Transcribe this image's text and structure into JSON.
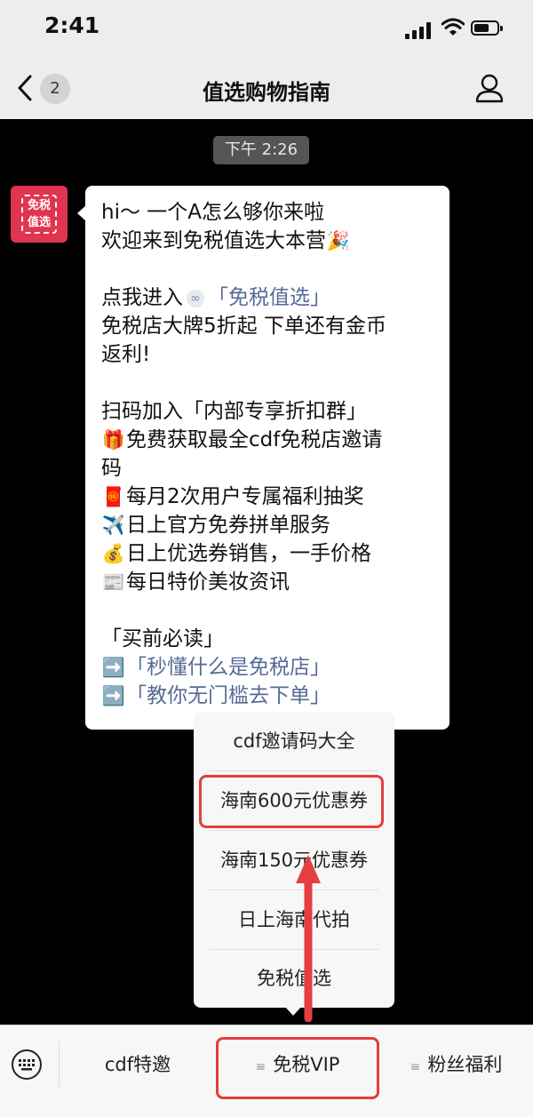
{
  "status": {
    "time": "2:41"
  },
  "nav": {
    "back_count": "2",
    "title": "值选购物指南"
  },
  "chat": {
    "timestamp": "下午 2:26",
    "avatar_text": [
      "免税",
      "值选"
    ],
    "message": {
      "l1": "hi～ 一个A怎么够你来啦",
      "l2": "欢迎来到免税值选大本营",
      "l2_emoji": "🎉",
      "l3_prefix": "点我进入",
      "l3_link": "「免税值选」",
      "l4": "免税店大牌5折起 下单还有金币",
      "l5": "返利!",
      "l6": "扫码加入「内部专享折扣群」",
      "l7_emoji": "🎁",
      "l7": "免费获取最全cdf免税店邀请",
      "l8": "码",
      "l9_emoji": "🧧",
      "l9": "每月2次用户专属福利抽奖",
      "l10_emoji": "✈️",
      "l10": "日上官方免券拼单服务",
      "l11_emoji": "💰",
      "l11": "日上优选券销售，一手价格",
      "l12_emoji": "📰",
      "l12": "每日特价美妆资讯",
      "l13": "「买前必读」",
      "l14_emoji": "➡️",
      "l14_link": "「秒懂什么是免税店」",
      "l15_emoji": "➡️",
      "l15_link": "「教你无门槛去下单」"
    }
  },
  "popup_menu": {
    "items": [
      "cdf邀请码大全",
      "海南600元优惠券",
      "海南150元优惠券",
      "日上海南代拍",
      "免税值选"
    ]
  },
  "bottom_tabs": {
    "tab1": "cdf特邀",
    "tab2": "免税VIP",
    "tab3": "粉丝福利",
    "menu_marker": "≡"
  },
  "colors": {
    "highlight": "#e53e3e",
    "link": "#576b95",
    "avatar": "#e0344f"
  }
}
